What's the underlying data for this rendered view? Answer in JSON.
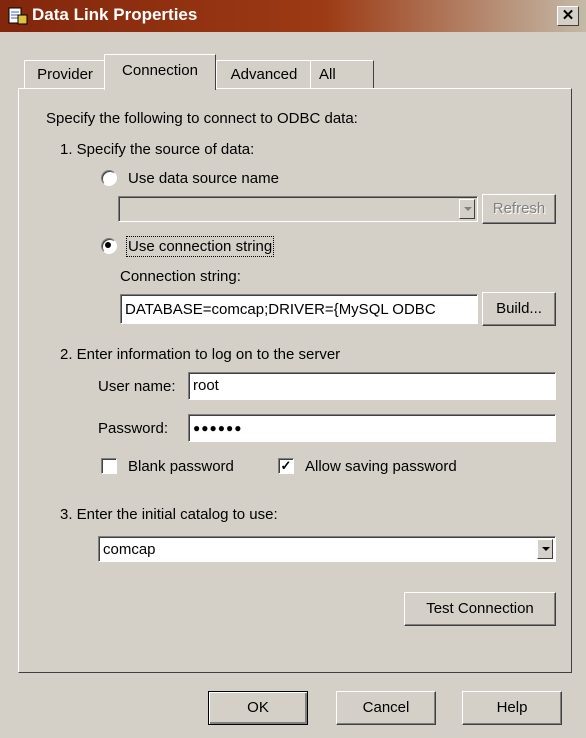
{
  "window": {
    "title": "Data Link Properties",
    "close_glyph": "✕"
  },
  "tabs": [
    "Provider",
    "Connection",
    "Advanced",
    "All"
  ],
  "intro": "Specify the following to connect to ODBC data:",
  "step1": {
    "label": "1. Specify the source of data:",
    "dsn_label": "Use data source name",
    "dsn_value": "",
    "refresh_label": "Refresh",
    "connstr_radio_label": "Use connection string",
    "connstr_label": "Connection string:",
    "connstr_value": "DATABASE=comcap;DRIVER={MySQL ODBC",
    "build_label": "Build..."
  },
  "step2": {
    "label": "2. Enter information to log on to the server",
    "username_label": "User name:",
    "username_value": "root",
    "password_label": "Password:",
    "password_value": "●●●●●●",
    "blank_password_label": "Blank password",
    "allow_saving_label": "Allow saving password",
    "checkmark": "✓"
  },
  "step3": {
    "label": "3. Enter the initial catalog to use:",
    "catalog_value": "comcap"
  },
  "test_connection_label": "Test Connection",
  "footer": {
    "ok_label": "OK",
    "cancel_label": "Cancel",
    "help_label": "Help"
  }
}
